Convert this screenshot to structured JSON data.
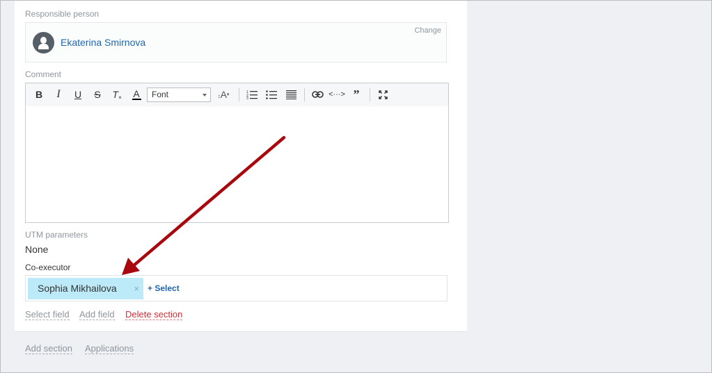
{
  "responsible": {
    "label": "Responsible person",
    "name": "Ekaterina Smirnova",
    "change_label": "Change"
  },
  "comment": {
    "label": "Comment",
    "toolbar": {
      "font_label": "Font",
      "buttons": [
        "bold",
        "italic",
        "underline",
        "strikethrough",
        "clear-format",
        "text-color",
        "font-size",
        "ordered-list",
        "unordered-list",
        "align",
        "link",
        "code",
        "quote",
        "fullscreen"
      ]
    }
  },
  "utm": {
    "label": "UTM parameters",
    "value": "None"
  },
  "coexecutor": {
    "label": "Co-executor",
    "tag": "Sophia Mikhailova",
    "remove_glyph": "×",
    "select_label": "Select"
  },
  "section_actions": {
    "select_field": "Select field",
    "add_field": "Add field",
    "delete_section": "Delete section"
  },
  "footer": {
    "add_section": "Add section",
    "applications": "Applications"
  },
  "colors": {
    "link": "#2067b0",
    "tag_bg": "#bceaf8",
    "delete": "#c9333a",
    "arrow": "#a8080d"
  }
}
